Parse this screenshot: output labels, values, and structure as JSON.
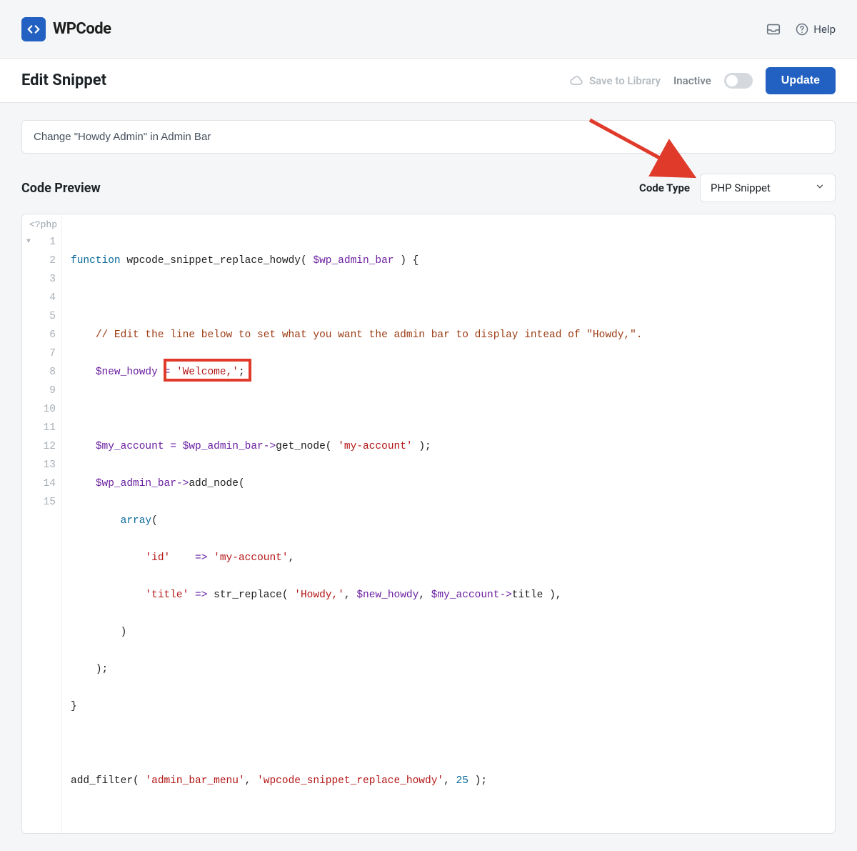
{
  "brand": {
    "name": "WPCode"
  },
  "topbar": {
    "help_label": "Help"
  },
  "subheader": {
    "page_title": "Edit Snippet",
    "save_library_label": "Save to Library",
    "status_label": "Inactive",
    "update_label": "Update"
  },
  "snippet": {
    "title": "Change \"Howdy Admin\" in Admin Bar"
  },
  "section": {
    "preview_title": "Code Preview",
    "code_type_label": "Code Type",
    "code_type_value": "PHP Snippet"
  },
  "editor": {
    "php_open": "<?php",
    "line_numbers": [
      "1",
      "2",
      "3",
      "4",
      "5",
      "6",
      "7",
      "8",
      "9",
      "10",
      "11",
      "12",
      "13",
      "14",
      "15"
    ],
    "tokens": {
      "kw_function": "function",
      "fn_name": "wpcode_snippet_replace_howdy",
      "var_wp_admin_bar": "$wp_admin_bar",
      "comment_line": "// Edit the line below to set what you want the admin bar to display intead of \"Howdy,\".",
      "var_new_howdy": "$new_howdy",
      "eq": " = ",
      "str_welcome": "'Welcome,'",
      "semi": ";",
      "var_my_account": "$my_account",
      "arrow": "->",
      "get_node": "get_node",
      "str_my_account": "'my-account'",
      "add_node": "add_node",
      "kw_array": "array",
      "str_id": "'id'",
      "arrow2": "=>",
      "str_title": "'title'",
      "str_replace": "str_replace",
      "str_howdy": "'Howdy,'",
      "title_prop": "title",
      "close_paren": ")",
      "close_paren_semi": ");",
      "close_brace": "}",
      "add_filter": "add_filter",
      "str_admin_bar_menu": "'admin_bar_menu'",
      "str_fn_name": "'wpcode_snippet_replace_howdy'",
      "num_25": "25"
    }
  },
  "annotations": {
    "arrow_color": "#e03a2a",
    "highlight_box_color": "#e03a2a"
  }
}
